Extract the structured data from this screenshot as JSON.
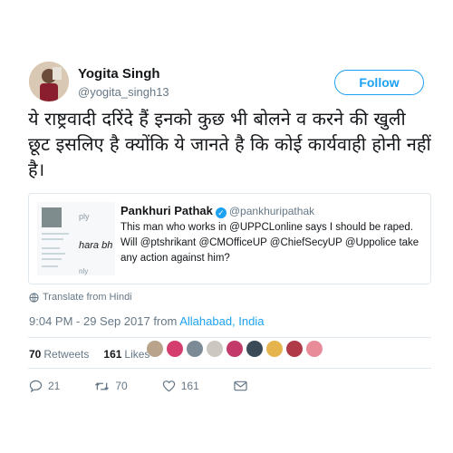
{
  "author": {
    "name": "Yogita Singh",
    "handle": "@yogita_singh13"
  },
  "follow_label": "Follow",
  "tweet_text": "ये राष्ट्रवादी दरिंदे हैं इनको कुछ भी बोलने व करने की खुली छूट इसलिए है क्योंकि ये जानते है कि कोई कार्यवाही होनी नहीं है।",
  "quote": {
    "name": "Pankhuri Pathak",
    "handle": "@pankhuripathak",
    "text": "This man who works in @UPPCLonline says I should be raped. Will @ptshrikant @CMOfficeUP @ChiefSecyUP @Uppolice take any action against him?",
    "image_text": [
      "ply",
      "hara bh",
      "nly"
    ]
  },
  "translate_label": "Translate from Hindi",
  "timestamp": {
    "time": "9:04 PM - 29 Sep 2017 from ",
    "place": "Allahabad, India"
  },
  "stats": {
    "retweets_count": "70",
    "retweets_label": "Retweets",
    "likes_count": "161",
    "likes_label": "Likes"
  },
  "actions": {
    "replies": "21",
    "retweets": "70",
    "likes": "161"
  },
  "colors": {
    "accent": "#1da1f2",
    "secondary_text": "#657786",
    "border": "#e1e8ed"
  }
}
